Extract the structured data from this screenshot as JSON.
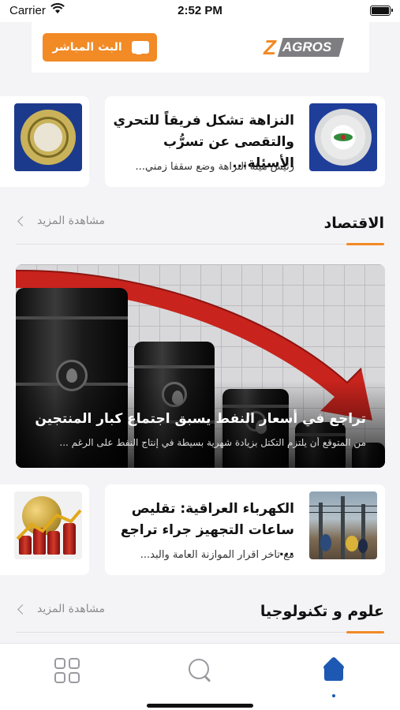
{
  "status_bar": {
    "carrier": "Carrier",
    "time": "2:52 PM"
  },
  "header": {
    "live_button_label": "البث المباشر",
    "logo_text": "ZAGROS",
    "logo_letter": "Z",
    "logo_rest": "AGROS"
  },
  "top_row": {
    "article": {
      "title": "النزاهة تشكل فريقاً للتحري والتقصى عن تسرُّب الأسئلة...",
      "excerpt": "رئيس هيئة النزاهة وضع سقفا زمني..."
    }
  },
  "sections": [
    {
      "title": "الاقتصاد",
      "more_label": "مشاهدة المزيد"
    },
    {
      "title": "علوم و تكنولوجيا",
      "more_label": "مشاهدة المزيد"
    }
  ],
  "featured": {
    "title": "تراجع في أسعار النفط يسبق اجتماع كبار المنتجين",
    "excerpt": "من المتوقع أن يلتزم التكتل بزيادة شهرية بسيطة في إنتاج النفط على الرغم ..."
  },
  "economy_row": {
    "article": {
      "title": "الكهرباء العراقية: تقليص ساعات التجهيز جراء تراجع ...",
      "excerpt": "مع تأخر اقرار الموازنة العامة والبد..."
    }
  },
  "tab_bar": {
    "tabs": [
      {
        "name": "categories",
        "icon": "grid-icon",
        "active": false
      },
      {
        "name": "search",
        "icon": "search-icon",
        "active": false
      },
      {
        "name": "home",
        "icon": "home-icon",
        "active": true
      }
    ],
    "active_color": "#1d58b3"
  },
  "colors": {
    "accent": "#f28a25",
    "background": "#f4f4f6"
  }
}
